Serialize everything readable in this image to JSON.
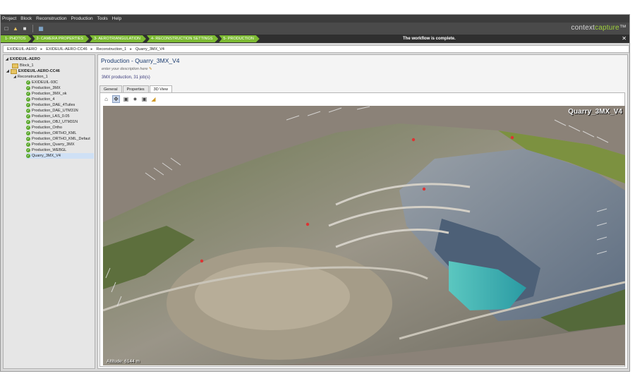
{
  "menu": [
    "Project",
    "Block",
    "Reconstruction",
    "Production",
    "Tools",
    "Help"
  ],
  "brand": {
    "prefix": "context",
    "suffix": "capture",
    "mark": "™"
  },
  "workflow": {
    "steps": [
      "1- PHOTOS",
      "2- CAMERA PROPERTIES",
      "3- AEROTRIANGULATION",
      "4- RECONSTRUCTION SETTINGS",
      "5- PRODUCTION"
    ],
    "status": "The workflow is complete."
  },
  "breadcrumb": [
    "EXIDEUIL-AERO",
    "EXIDEUIL-AERO-CC46",
    "Reconstruction_1",
    "Quarry_3MX_V4"
  ],
  "tree": {
    "root": "EXIDEUIL-AERO",
    "block1": "Block_1",
    "block2": "EXIDEUIL-AERO-CC46",
    "reconstruction": "Reconstruction_1",
    "items": [
      "EXIDEUIL-93C",
      "Production_3MX",
      "Production_3MX_ok",
      "Production_4",
      "Production_DAE_4Tuiles",
      "Production_DAE_UTM31N",
      "Production_LAS_0.05",
      "Production_OBJ_UTM31N",
      "Production_Ortho",
      "Production_ORTHO_KML",
      "Production_ORTHO_KML_Defaut",
      "Production_Quarry_3MX",
      "Production_WEBGL",
      "Quarry_3MX_V4"
    ],
    "selected": "Quarry_3MX_V4"
  },
  "panel": {
    "title": "Production - Quarry_3MX_V4",
    "description": "enter your description here",
    "info": "3MX production, 31 job(s)",
    "tabs": [
      "General",
      "Properties",
      "3D View"
    ],
    "active_tab": "3D View"
  },
  "viewer": {
    "label": "Quarry_3MX_V4",
    "altitude": "Altitude: 6144 m",
    "tools": [
      "home-icon",
      "orbit-icon",
      "select-icon",
      "camera-small-icon",
      "camera-icon",
      "measure-icon"
    ]
  },
  "colors": {
    "accent_green": "#7dbb33",
    "title_blue": "#1a3b6e",
    "selected_row": "#cfe0f5"
  }
}
